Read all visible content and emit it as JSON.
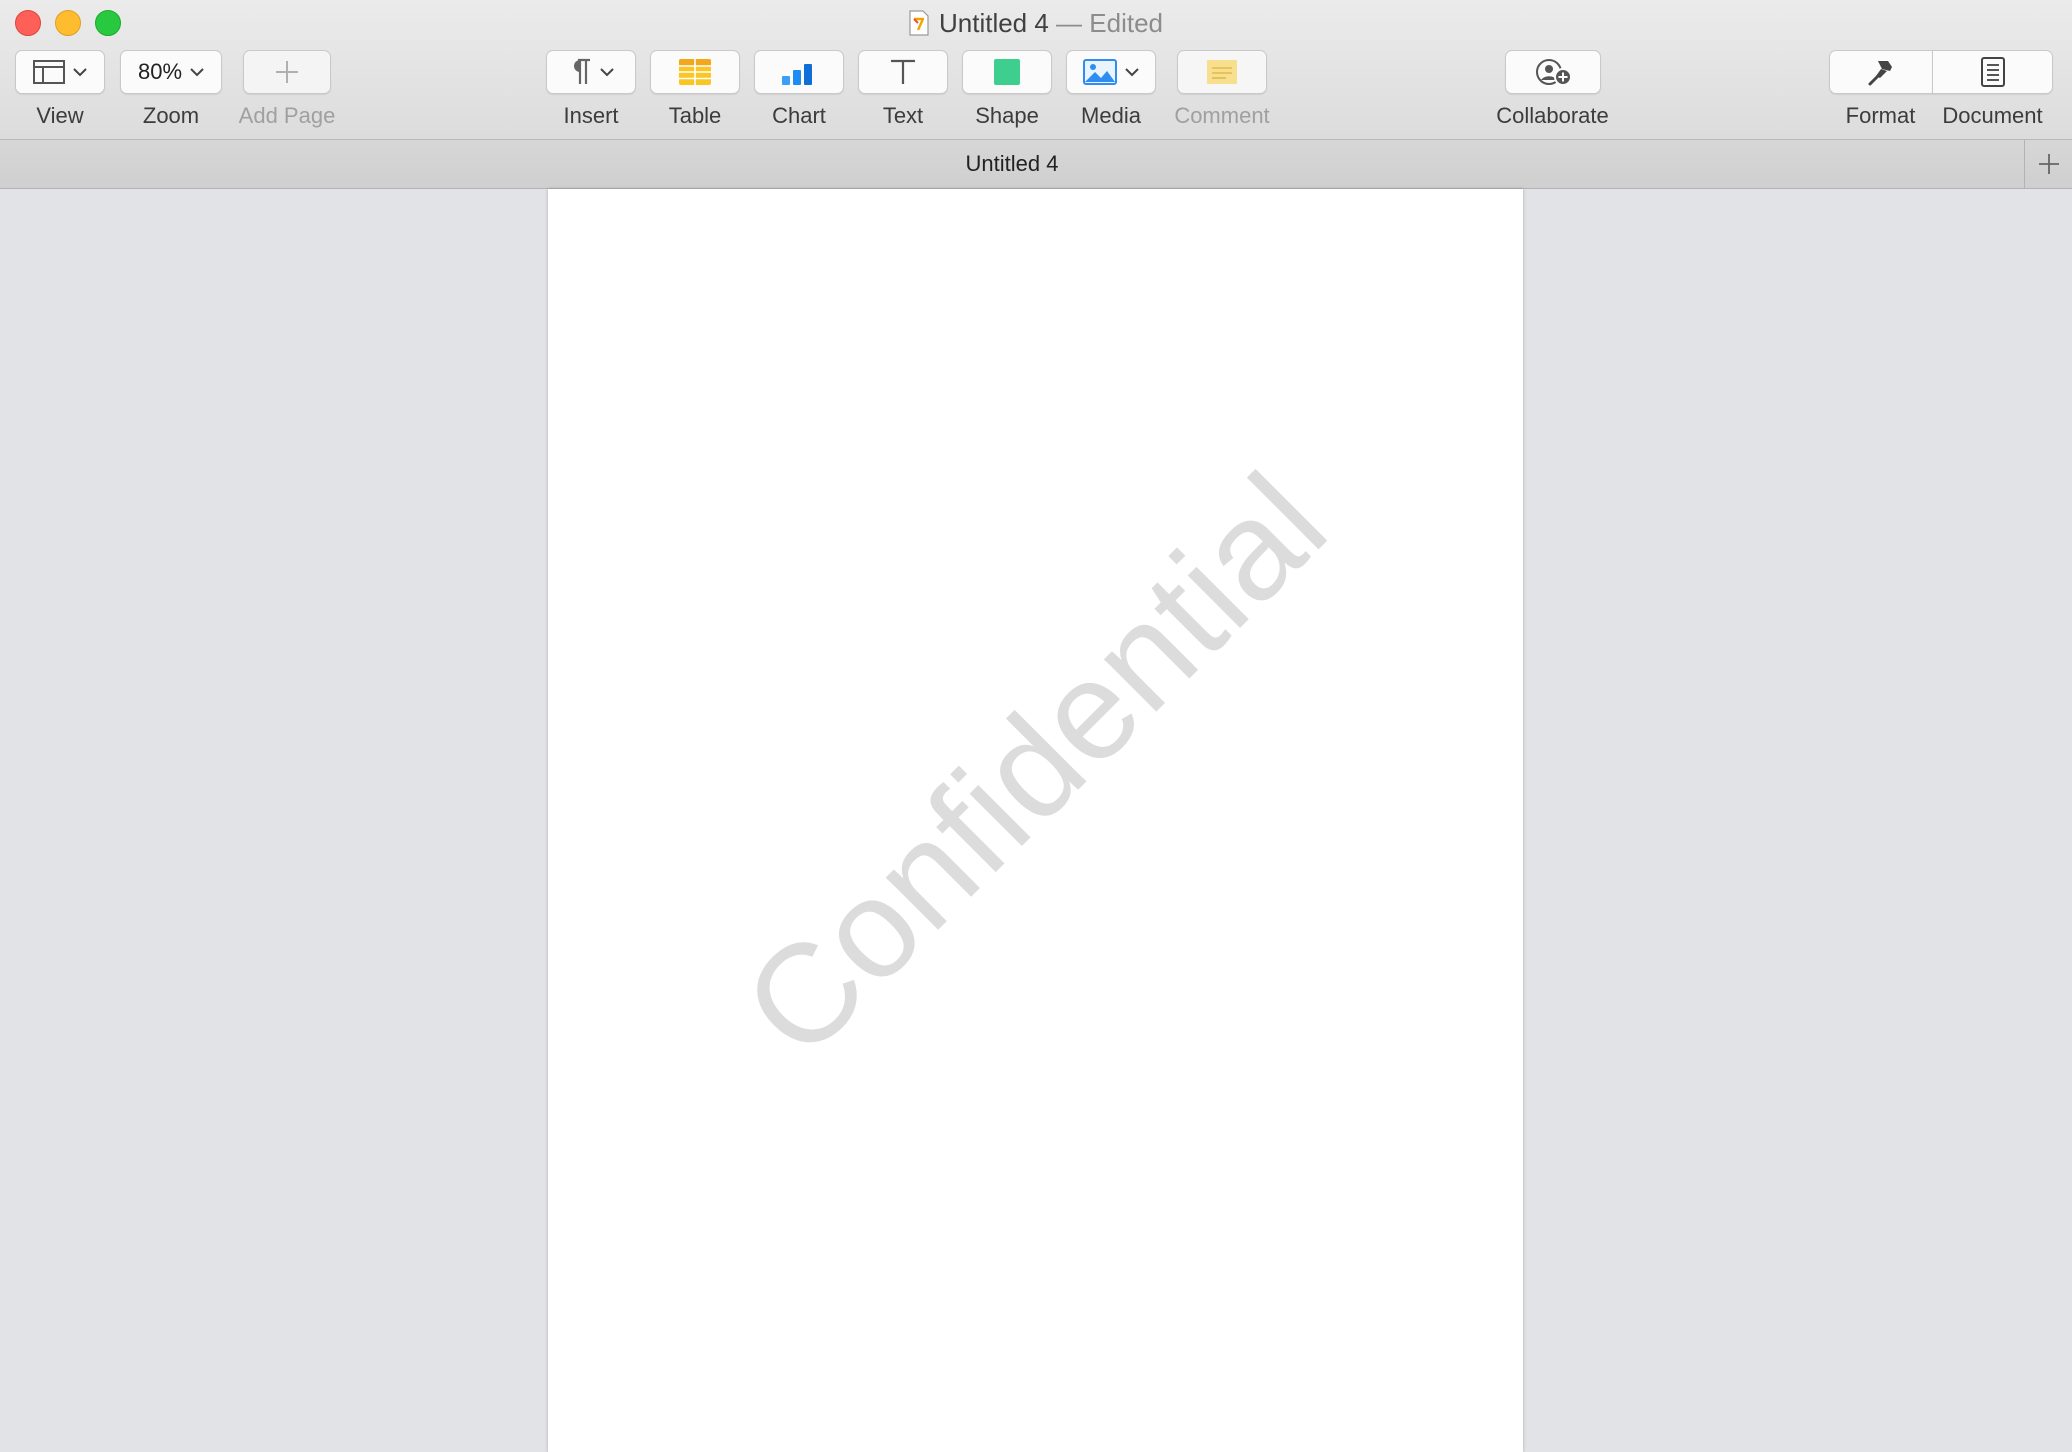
{
  "window": {
    "title": "Untitled 4",
    "title_suffix": " — Edited"
  },
  "toolbar": {
    "view_label": "View",
    "zoom_value": "80%",
    "zoom_label": "Zoom",
    "add_page_label": "Add Page",
    "insert_label": "Insert",
    "table_label": "Table",
    "chart_label": "Chart",
    "text_label": "Text",
    "shape_label": "Shape",
    "media_label": "Media",
    "comment_label": "Comment",
    "collaborate_label": "Collaborate",
    "format_label": "Format",
    "document_label": "Document"
  },
  "tabbar": {
    "tab_title": "Untitled 4"
  },
  "document": {
    "watermark": "Confidential"
  },
  "colors": {
    "close": "#fe5f57",
    "minimize": "#febc2e",
    "zoom": "#28c840",
    "table_icon": "#f9c623",
    "chart_icon": "#1e8cf5",
    "shape_icon": "#3ecf8e",
    "comment_icon": "#f8df8e"
  },
  "icons": [
    "view-layout-icon",
    "chevron-down-icon",
    "plus-icon",
    "paragraph-icon",
    "table-icon",
    "chart-icon",
    "text-icon",
    "shape-icon",
    "media-icon",
    "comment-icon",
    "collaborate-icon",
    "format-brush-icon",
    "document-icon",
    "new-tab-plus-icon",
    "pages-document-icon"
  ]
}
